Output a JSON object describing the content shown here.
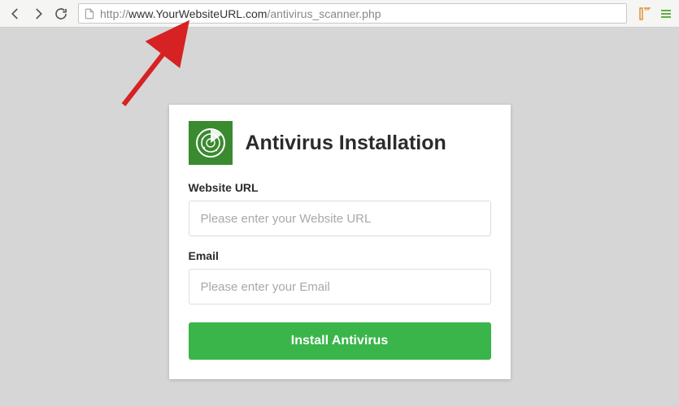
{
  "browser": {
    "url": {
      "protocol": "http://",
      "domain": "www.YourWebsiteURL.com",
      "path": "/antivirus_scanner.php"
    }
  },
  "card": {
    "title": "Antivirus Installation",
    "fields": {
      "website": {
        "label": "Website URL",
        "placeholder": "Please enter your Website URL",
        "value": ""
      },
      "email": {
        "label": "Email",
        "placeholder": "Please enter your Email",
        "value": ""
      }
    },
    "install_label": "Install Antivirus"
  },
  "colors": {
    "accent_green": "#3ab54a",
    "logo_green": "#3a8a2f",
    "arrow_red": "#d62222"
  }
}
